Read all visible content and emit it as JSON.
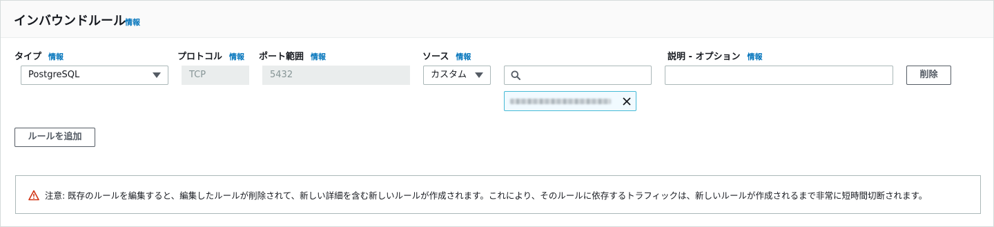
{
  "header": {
    "title": "インバウンドルール",
    "info": "情報"
  },
  "columns": {
    "type": {
      "label": "タイプ",
      "info": "情報"
    },
    "protocol": {
      "label": "プロトコル",
      "info": "情報"
    },
    "port": {
      "label": "ポート範囲",
      "info": "情報"
    },
    "source": {
      "label": "ソース",
      "info": "情報"
    },
    "description": {
      "label": "説明 - オプション",
      "info": "情報"
    }
  },
  "rule": {
    "type_value": "PostgreSQL",
    "protocol_value": "TCP",
    "port_value": "5432",
    "source_value": "カスタム",
    "search_value": "",
    "description_value": "",
    "delete_label": "削除"
  },
  "add_rule_label": "ルールを追加",
  "alert": {
    "text": "注意: 既存のルールを編集すると、編集したルールが削除されて、新しい詳細を含む新しいルールが作成されます。これにより、そのルールに依存するトラフィックは、新しいルールが作成されるまで非常に短時間切断されます。"
  },
  "icons": {
    "search": "search-icon",
    "close": "close-icon",
    "warning": "warning-icon",
    "caret": "caret-down-icon"
  },
  "colors": {
    "link": "#0073bb",
    "warning": "#d13212",
    "token_border": "#44b9d6"
  }
}
